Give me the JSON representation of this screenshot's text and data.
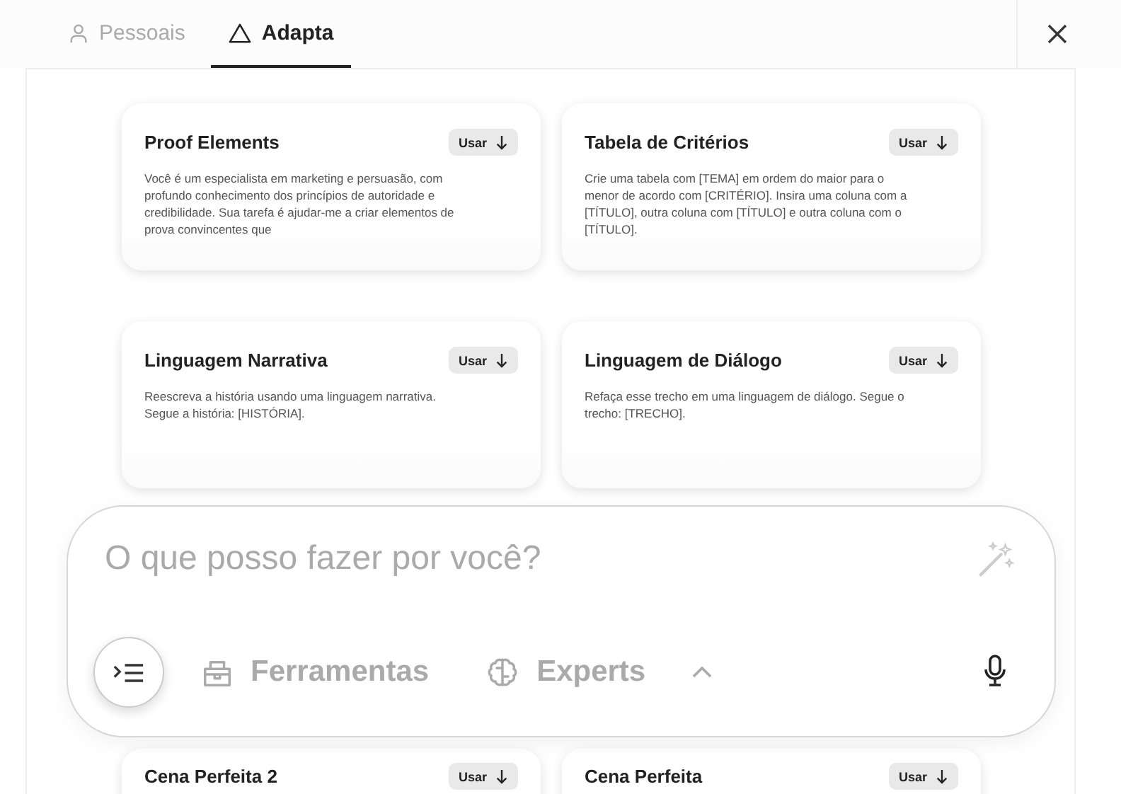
{
  "tabs": [
    {
      "label": "Pessoais",
      "selected": false
    },
    {
      "label": "Adapta",
      "selected": true
    }
  ],
  "prompts": [
    {
      "title": "Proof Elements",
      "button": "Usar",
      "text": "Você é um especialista em marketing e persuasão, com profundo conhecimento dos princípios de autoridade e credibilidade. Sua tarefa é ajudar-me a criar elementos de prova convincentes que"
    },
    {
      "title": "Tabela de Critérios",
      "button": "Usar",
      "text": "Crie uma tabela com [TEMA] em ordem do maior para o menor de acordo com [CRITÉRIO]. Insira uma coluna com a [TÍTULO], outra coluna com [TÍTULO] e outra coluna com o [TÍTULO]."
    },
    {
      "title": "Linguagem Narrativa",
      "button": "Usar",
      "text": "Reescreva a história usando uma linguagem narrativa. Segue a história: [HISTÓRIA]."
    },
    {
      "title": "Linguagem de Diálogo",
      "button": "Usar",
      "text": "Refaça esse trecho em uma linguagem de diálogo. Segue o trecho: [TRECHO]."
    },
    {
      "title": "Cena Perfeita 2",
      "button": "Usar"
    },
    {
      "title": "Cena Perfeita",
      "button": "Usar"
    }
  ],
  "composer": {
    "placeholder": "O que posso fazer por você?",
    "tools": [
      {
        "label": "Ferramentas"
      },
      {
        "label": "Experts"
      }
    ]
  }
}
